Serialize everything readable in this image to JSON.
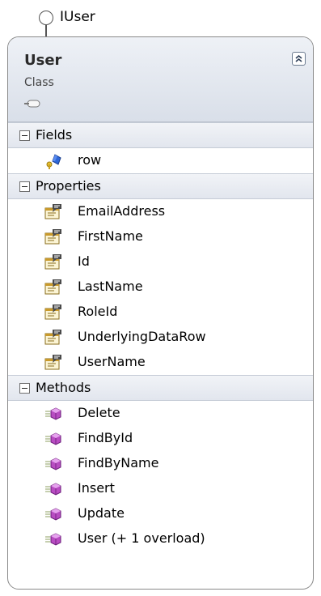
{
  "interface": {
    "name": "IUser"
  },
  "class": {
    "name": "User",
    "kind": "Class"
  },
  "compartments": [
    {
      "title": "Fields",
      "icon": "field-icon",
      "items": [
        "row"
      ]
    },
    {
      "title": "Properties",
      "icon": "property-icon",
      "items": [
        "EmailAddress",
        "FirstName",
        "Id",
        "LastName",
        "RoleId",
        "UnderlyingDataRow",
        "UserName"
      ]
    },
    {
      "title": "Methods",
      "icon": "method-icon",
      "items": [
        "Delete",
        "FindById",
        "FindByName",
        "Insert",
        "Update",
        "User (+ 1 overload)"
      ]
    }
  ]
}
